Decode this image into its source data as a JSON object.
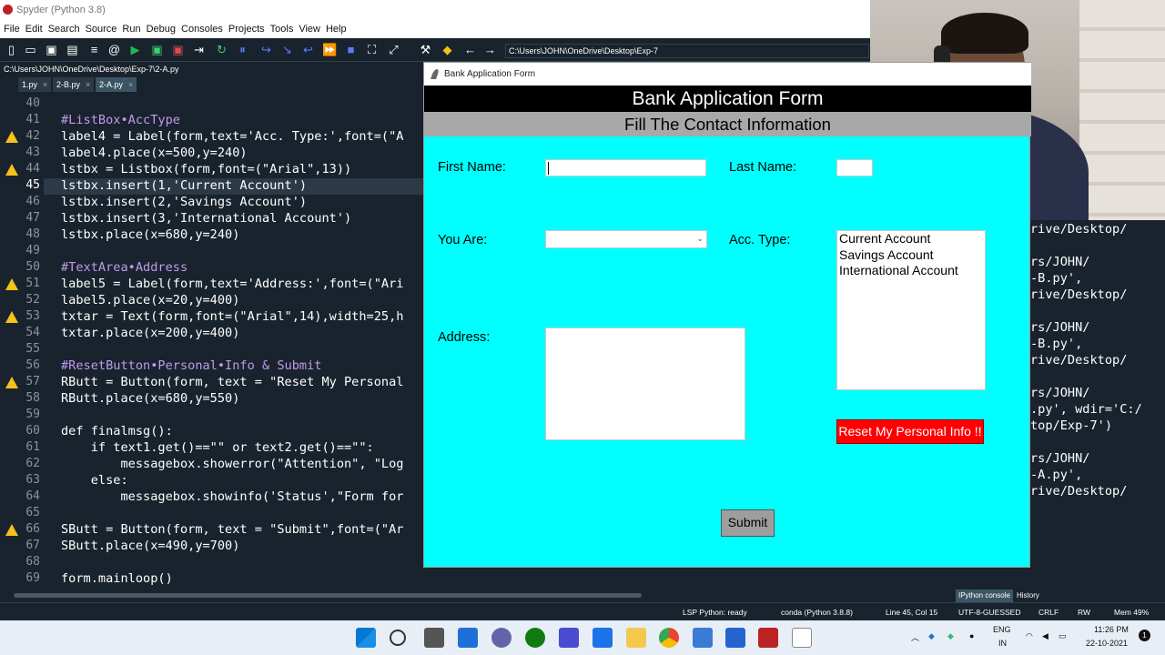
{
  "window": {
    "title": "Spyder (Python 3.8)"
  },
  "menu": [
    "File",
    "Edit",
    "Search",
    "Source",
    "Run",
    "Debug",
    "Consoles",
    "Projects",
    "Tools",
    "View",
    "Help"
  ],
  "toolbar": {
    "path": "C:\\Users\\JOHN\\OneDrive\\Desktop\\Exp-7"
  },
  "editor": {
    "file_path": "C:\\Users\\JOHN\\OneDrive\\Desktop\\Exp-7\\2-A.py",
    "tabs": [
      {
        "label": "1.py"
      },
      {
        "label": "2-B.py"
      },
      {
        "label": "2-A.py"
      }
    ],
    "current_line": "45",
    "lines": [
      {
        "n": "40",
        "text": ""
      },
      {
        "n": "41",
        "text": "#ListBox•AccType"
      },
      {
        "n": "42",
        "text": "label4 = Label(form,text='Acc. Type:',font=(\"A"
      },
      {
        "n": "43",
        "text": "label4.place(x=500,y=240)"
      },
      {
        "n": "44",
        "text": "lstbx = Listbox(form,font=(\"Arial\",13))"
      },
      {
        "n": "45",
        "text": "lstbx.insert(1,'Current Account')"
      },
      {
        "n": "46",
        "text": "lstbx.insert(2,'Savings Account')"
      },
      {
        "n": "47",
        "text": "lstbx.insert(3,'International Account')"
      },
      {
        "n": "48",
        "text": "lstbx.place(x=680,y=240)"
      },
      {
        "n": "49",
        "text": ""
      },
      {
        "n": "50",
        "text": "#TextArea•Address"
      },
      {
        "n": "51",
        "text": "label5 = Label(form,text='Address:',font=(\"Ari"
      },
      {
        "n": "52",
        "text": "label5.place(x=20,y=400)"
      },
      {
        "n": "53",
        "text": "txtar = Text(form,font=(\"Arial\",14),width=25,h"
      },
      {
        "n": "54",
        "text": "txtar.place(x=200,y=400)"
      },
      {
        "n": "55",
        "text": ""
      },
      {
        "n": "56",
        "text": "#ResetButton•Personal•Info & Submit"
      },
      {
        "n": "57",
        "text": "RButt = Button(form, text = \"Reset My Personal"
      },
      {
        "n": "58",
        "text": "RButt.place(x=680,y=550)"
      },
      {
        "n": "59",
        "text": ""
      },
      {
        "n": "60",
        "text": "def finalmsg():"
      },
      {
        "n": "61",
        "text": "    if text1.get()==\"\" or text2.get()==\"\":"
      },
      {
        "n": "62",
        "text": "        messagebox.showerror(\"Attention\", \"Log"
      },
      {
        "n": "63",
        "text": "    else:"
      },
      {
        "n": "64",
        "text": "        messagebox.showinfo('Status',\"Form for"
      },
      {
        "n": "65",
        "text": ""
      },
      {
        "n": "66",
        "text": "SButt = Button(form, text = \"Submit\",font=(\"Ar"
      },
      {
        "n": "67",
        "text": "SButt.place(x=490,y=700)"
      },
      {
        "n": "68",
        "text": ""
      },
      {
        "n": "69",
        "text": "form.mainloop()"
      }
    ]
  },
  "console": {
    "lines": [
      "rive/Desktop/",
      "",
      "rs/JOHN/",
      "-B.py',",
      "rive/Desktop/",
      "",
      "rs/JOHN/",
      "-B.py',",
      "rive/Desktop/",
      "",
      "rs/JOHN/",
      ".py', wdir='C:/",
      "top/Exp-7')",
      "",
      "rs/JOHN/",
      "-A.py',",
      "rive/Desktop/"
    ],
    "tabs": [
      "IPython console",
      "History"
    ]
  },
  "statusbar": {
    "lsp": "LSP Python: ready",
    "env": "conda (Python 3.8.8)",
    "position": "Line 45, Col 15",
    "encoding": "UTF-8-GUESSED",
    "eol": "CRLF",
    "perm": "RW",
    "mem": "Mem 49%"
  },
  "taskbar": {
    "lang": "ENG",
    "region": "IN",
    "time": "11:26 PM",
    "date": "22-10-2021",
    "notif": "1"
  },
  "form": {
    "window_title": "Bank Application Form",
    "heading": "Bank Application Form",
    "subheading": "Fill The Contact Information",
    "first_name_label": "First Name:",
    "last_name_label": "Last Name:",
    "you_are_label": "You Are:",
    "acc_type_label": "Acc. Type:",
    "address_label": "Address:",
    "acc_types": [
      "Current Account",
      "Savings Account",
      "International Account"
    ],
    "reset_button": "Reset My Personal Info !!",
    "submit_button": "Submit",
    "colors": {
      "background": "#00ffff",
      "reset": "#ff0000",
      "header": "#000000",
      "subheader": "#a8a8a8"
    }
  }
}
